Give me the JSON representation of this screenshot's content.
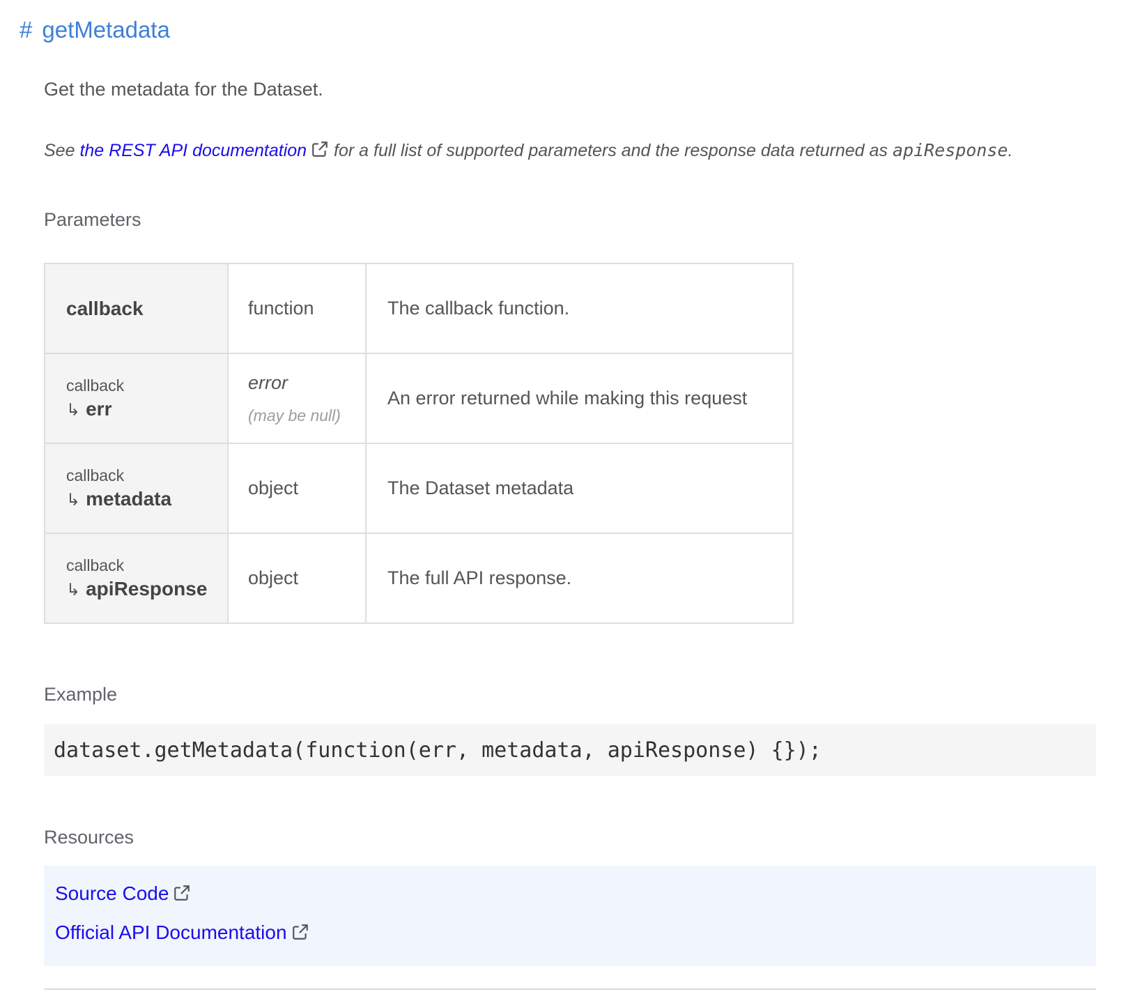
{
  "heading": {
    "hash": "#",
    "method_name": "getMetadata"
  },
  "description": "Get the metadata for the Dataset.",
  "note": {
    "prefix": "See ",
    "link_text": "the REST API documentation",
    "middle": " for a full list of supported parameters and the response data returned as ",
    "code": "apiResponse",
    "suffix": "."
  },
  "parameters": {
    "title": "Parameters",
    "rows": [
      {
        "parent": "",
        "name": "callback",
        "type": "function",
        "nullable": "",
        "description": "The callback function."
      },
      {
        "parent": "callback",
        "name": "err",
        "type": "error",
        "nullable": "(may be null)",
        "description": "An error returned while making this request"
      },
      {
        "parent": "callback",
        "name": "metadata",
        "type": "object",
        "nullable": "",
        "description": "The Dataset metadata"
      },
      {
        "parent": "callback",
        "name": "apiResponse",
        "type": "object",
        "nullable": "",
        "description": "The full API response."
      }
    ],
    "child_arrow": "↳"
  },
  "example": {
    "title": "Example",
    "code": "dataset.getMetadata(function(err, metadata, apiResponse) {});"
  },
  "resources": {
    "title": "Resources",
    "links": [
      {
        "label": "Source Code",
        "icon": "external-link-icon"
      },
      {
        "label": "Official API Documentation",
        "icon": "external-link-icon"
      }
    ]
  },
  "colors": {
    "heading": "#3f7fd6",
    "link": "#1a0dea",
    "text": "#555555",
    "table_header_bg": "#f4f4f4",
    "code_bg": "#f5f5f5",
    "resources_bg": "#f1f5fd"
  }
}
